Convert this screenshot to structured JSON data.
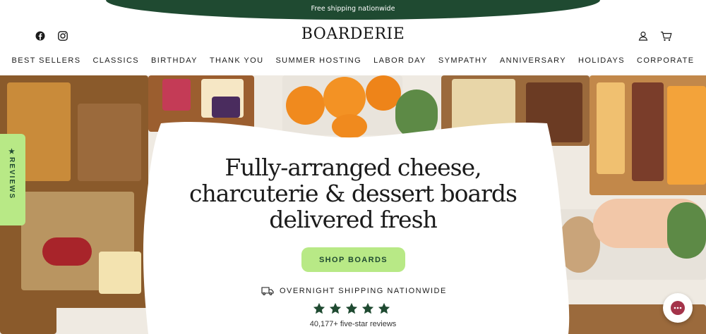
{
  "announcement": "Free shipping nationwide",
  "brand": {
    "logo_text": "BOARDERIE"
  },
  "icons": {
    "facebook": "facebook-icon",
    "instagram": "instagram-icon",
    "account": "user-icon",
    "cart": "cart-icon",
    "truck": "truck-icon",
    "star": "star-icon",
    "chat": "chat-icon"
  },
  "nav": {
    "items": [
      "BEST SELLERS",
      "CLASSICS",
      "BIRTHDAY",
      "THANK YOU",
      "SUMMER HOSTING",
      "LABOR DAY",
      "SYMPATHY",
      "ANNIVERSARY",
      "HOLIDAYS",
      "CORPORATE"
    ]
  },
  "hero": {
    "headline_line1": "Fully-arranged cheese,",
    "headline_line2": "charcuterie & dessert boards",
    "headline_line3": "delivered fresh",
    "cta_label": "SHOP BOARDS",
    "shipping_text": "OVERNIGHT SHIPPING NATIONWIDE",
    "rating_stars": 5,
    "reviews_text": "40,177+ five-star reviews"
  },
  "reviews_tab": "★REVIEWS",
  "colors": {
    "brand_green": "#1f4a31",
    "accent_lime": "#b8e986",
    "star_green": "#1f4a31"
  }
}
